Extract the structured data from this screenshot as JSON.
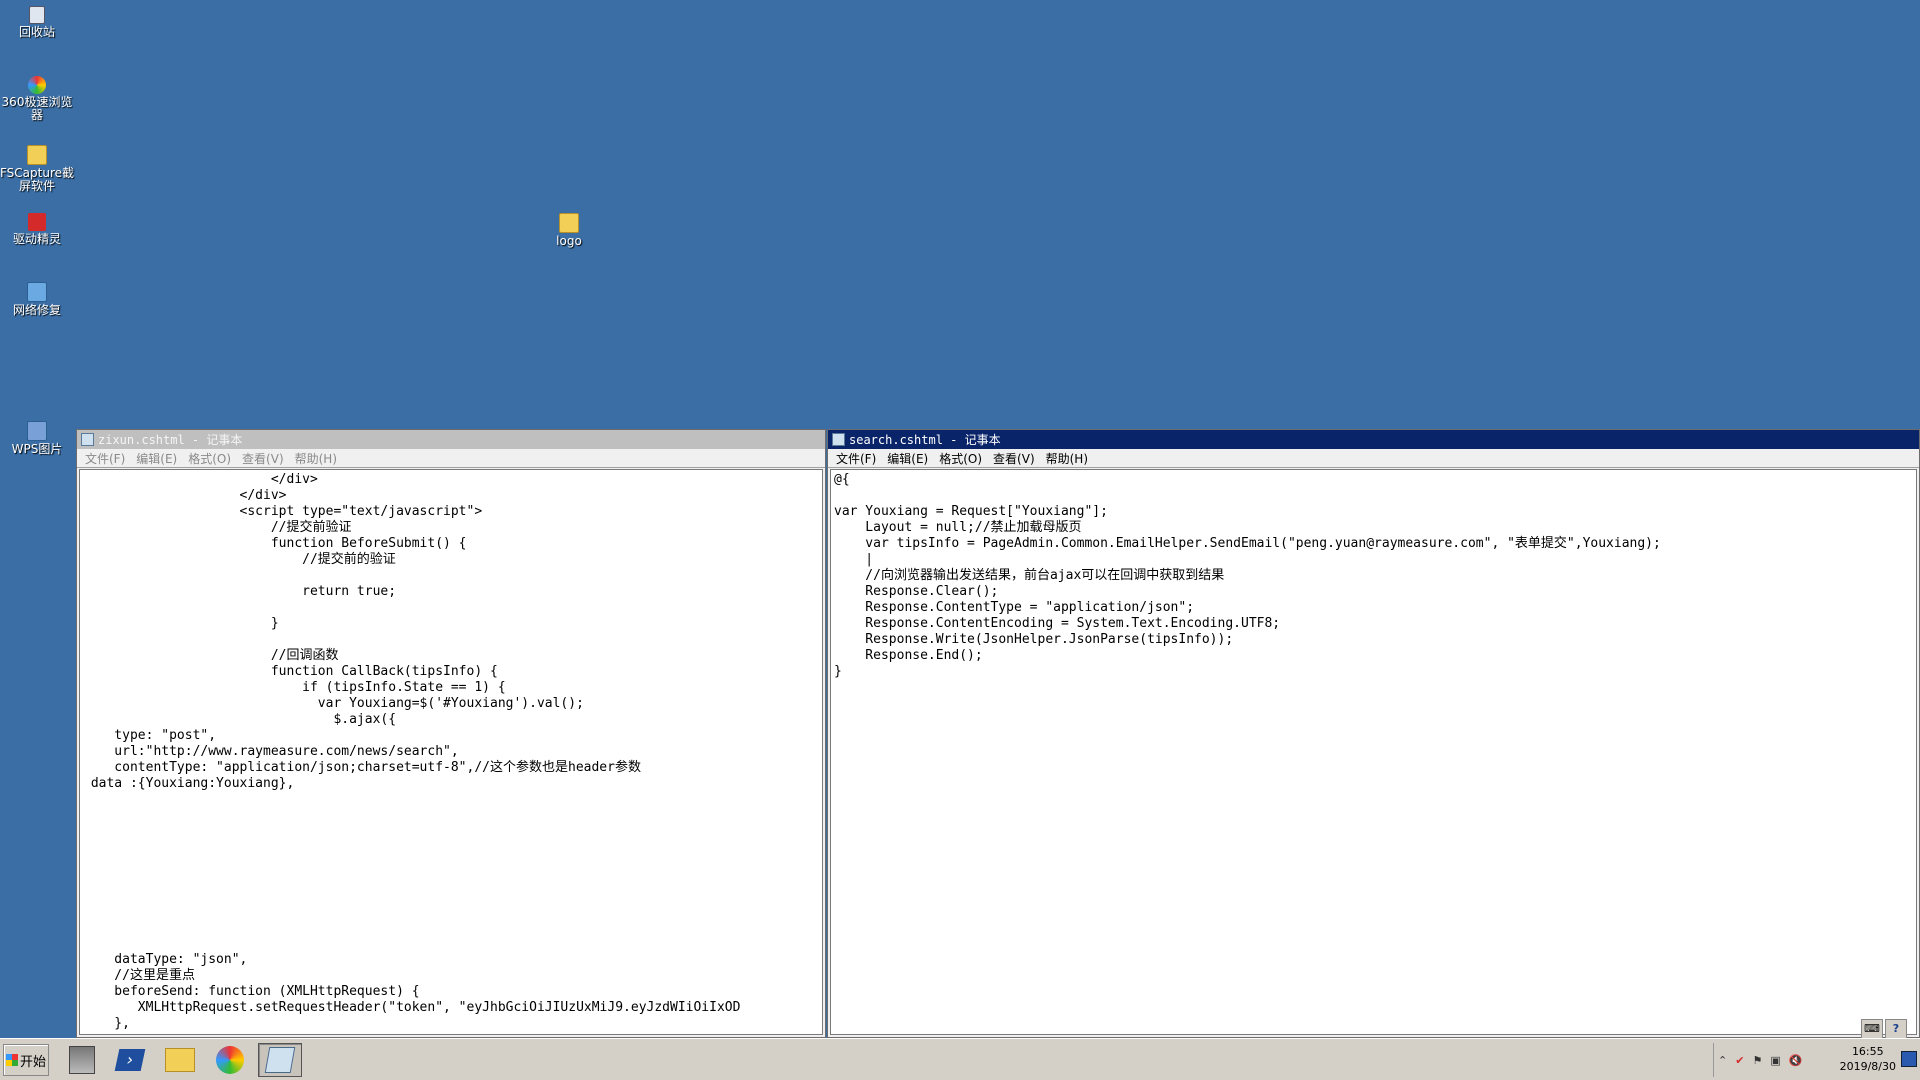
{
  "desktop": {
    "icons": [
      {
        "label": "回收站",
        "icon": "recycle-bin-icon"
      },
      {
        "label": "360极速浏览器",
        "icon": "360-browser-icon"
      },
      {
        "label": "FSCapture截屏软件",
        "icon": "folder-icon"
      },
      {
        "label": "驱动精灵",
        "icon": "driver-genius-icon"
      },
      {
        "label": "网络修复",
        "icon": "network-repair-icon"
      },
      {
        "label": "WPS图片",
        "icon": "wps-picture-icon"
      },
      {
        "label": "logo",
        "icon": "folder-icon"
      }
    ]
  },
  "windows": {
    "left": {
      "title": "zixun.cshtml - 记事本",
      "menu": [
        "文件(F)",
        "编辑(E)",
        "格式(O)",
        "查看(V)",
        "帮助(H)"
      ],
      "content": "                        </div>\n                    </div>\n                    <script type=\"text/javascript\">\n                        //提交前验证\n                        function BeforeSubmit() {\n                            //提交前的验证\n\n                            return true;\n\n                        }\n\n                        //回调函数\n                        function CallBack(tipsInfo) {\n                            if (tipsInfo.State == 1) {\n                              var Youxiang=$('#Youxiang').val();\n                                $.ajax({\n    type: \"post\",\n    url:\"http://www.raymeasure.com/news/search\",\n    contentType: \"application/json;charset=utf-8\",//这个参数也是header参数\n data :{Youxiang:Youxiang},\n\n\n\n\n\n\n\n\n\n\n    dataType: \"json\",\n    //这里是重点\n    beforeSend: function (XMLHttpRequest) {\n       XMLHttpRequest.setRequestHeader(\"token\", \"eyJhbGciOiJIUzUxMiJ9.eyJzdWIiOiIxOD\n    },"
    },
    "right": {
      "title": "search.cshtml - 记事本",
      "menu": [
        "文件(F)",
        "编辑(E)",
        "格式(O)",
        "查看(V)",
        "帮助(H)"
      ],
      "content": "@{\n\nvar Youxiang = Request[\"Youxiang\"];\n    Layout = null;//禁止加载母版页\n    var tipsInfo = PageAdmin.Common.EmailHelper.SendEmail(\"peng.yuan@raymeasure.com\", \"表单提交\",Youxiang);\n    |\n    //向浏览器输出发送结果，前台ajax可以在回调中获取到结果\n    Response.Clear();\n    Response.ContentType = \"application/json\";\n    Response.ContentEncoding = System.Text.Encoding.UTF8;\n    Response.Write(JsonHelper.JsonParse(tipsInfo));\n    Response.End();\n}"
    }
  },
  "taskbar": {
    "start_label": "开始",
    "clock_time": "16:55",
    "clock_date": "2019/8/30"
  }
}
